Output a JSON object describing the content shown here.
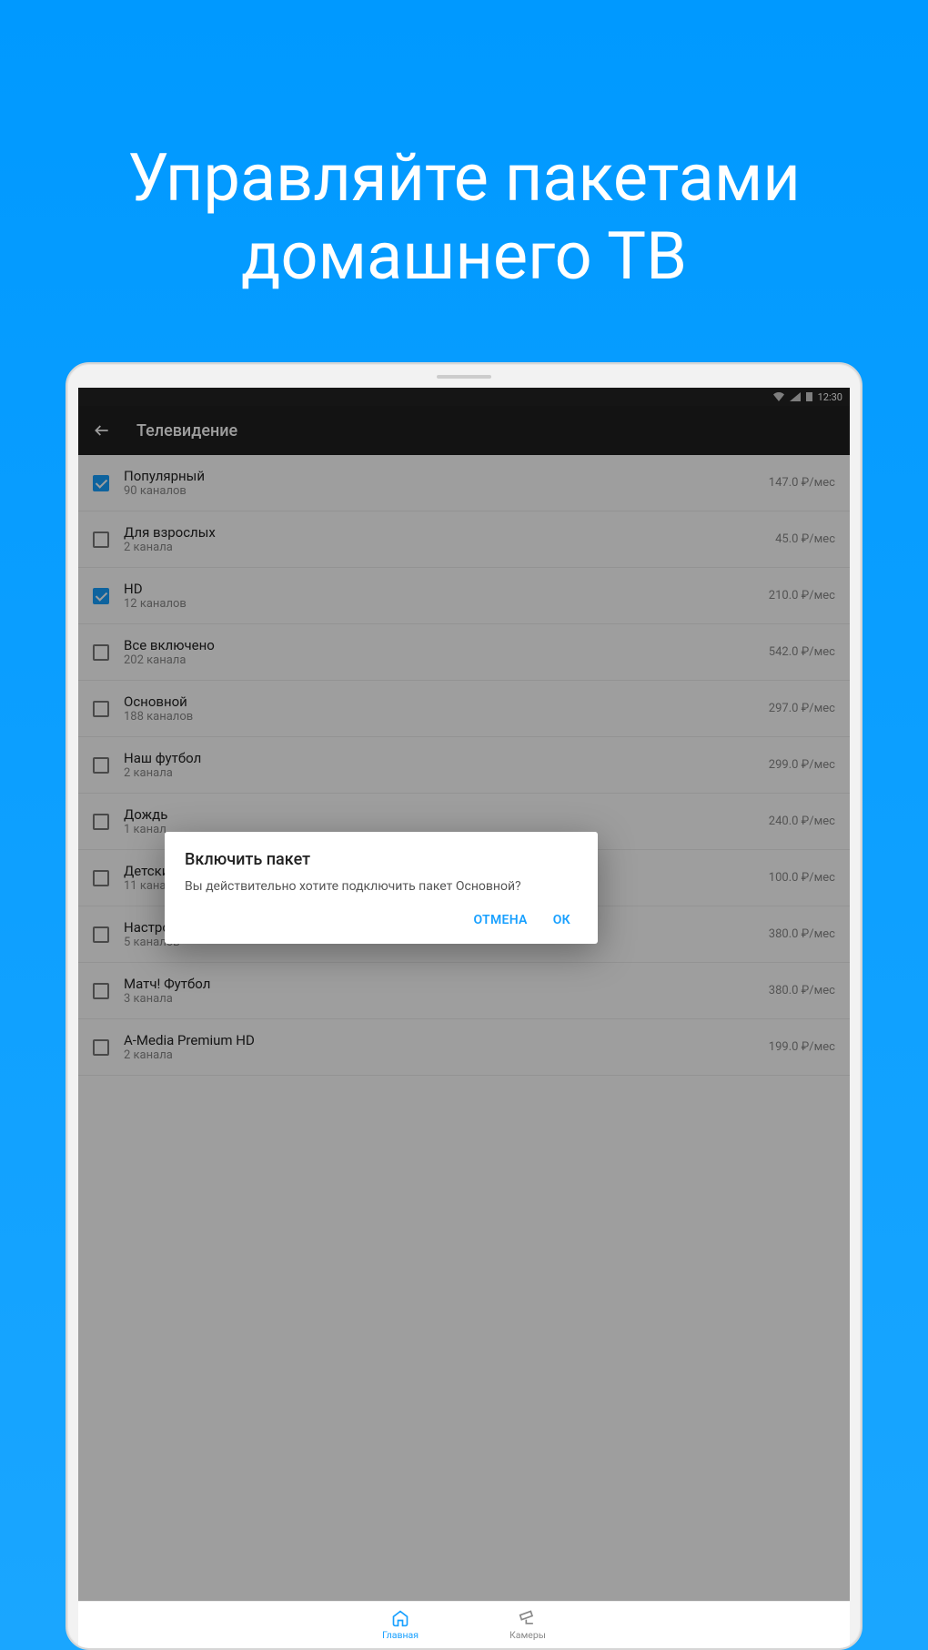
{
  "promo_title": "Управляйте пакетами\nдомашнего ТВ",
  "statusbar": {
    "time": "12:30"
  },
  "appbar": {
    "title": "Телевидение"
  },
  "packages": [
    {
      "name": "Популярный",
      "sub": "90 каналов",
      "price": "147.0 ₽/мес",
      "checked": true
    },
    {
      "name": "Для взрослых",
      "sub": "2 канала",
      "price": "45.0 ₽/мес",
      "checked": false
    },
    {
      "name": "HD",
      "sub": "12 каналов",
      "price": "210.0 ₽/мес",
      "checked": true
    },
    {
      "name": "Все включено",
      "sub": "202 канала",
      "price": "542.0 ₽/мес",
      "checked": false
    },
    {
      "name": "Основной",
      "sub": "188 каналов",
      "price": "297.0 ₽/мес",
      "checked": false
    },
    {
      "name": "Наш футбол",
      "sub": "2 канала",
      "price": "299.0 ₽/мес",
      "checked": false
    },
    {
      "name": "Дождь",
      "sub": "1 канал",
      "price": "240.0 ₽/мес",
      "checked": false
    },
    {
      "name": "Детский",
      "sub": "11 каналов",
      "price": "100.0 ₽/мес",
      "checked": false
    },
    {
      "name": "Настрой кино",
      "sub": "5 каналов",
      "price": "380.0 ₽/мес",
      "checked": false
    },
    {
      "name": "Матч! Футбол",
      "sub": "3 канала",
      "price": "380.0 ₽/мес",
      "checked": false
    },
    {
      "name": "A-Media Premium HD",
      "sub": "2 канала",
      "price": "199.0 ₽/мес",
      "checked": false
    }
  ],
  "dialog": {
    "title": "Включить пакет",
    "message": "Вы действительно хотите подключить пакет Основной?",
    "cancel": "ОТМЕНА",
    "ok": "ОК"
  },
  "bottomnav": {
    "home": "Главная",
    "cameras": "Камеры"
  }
}
